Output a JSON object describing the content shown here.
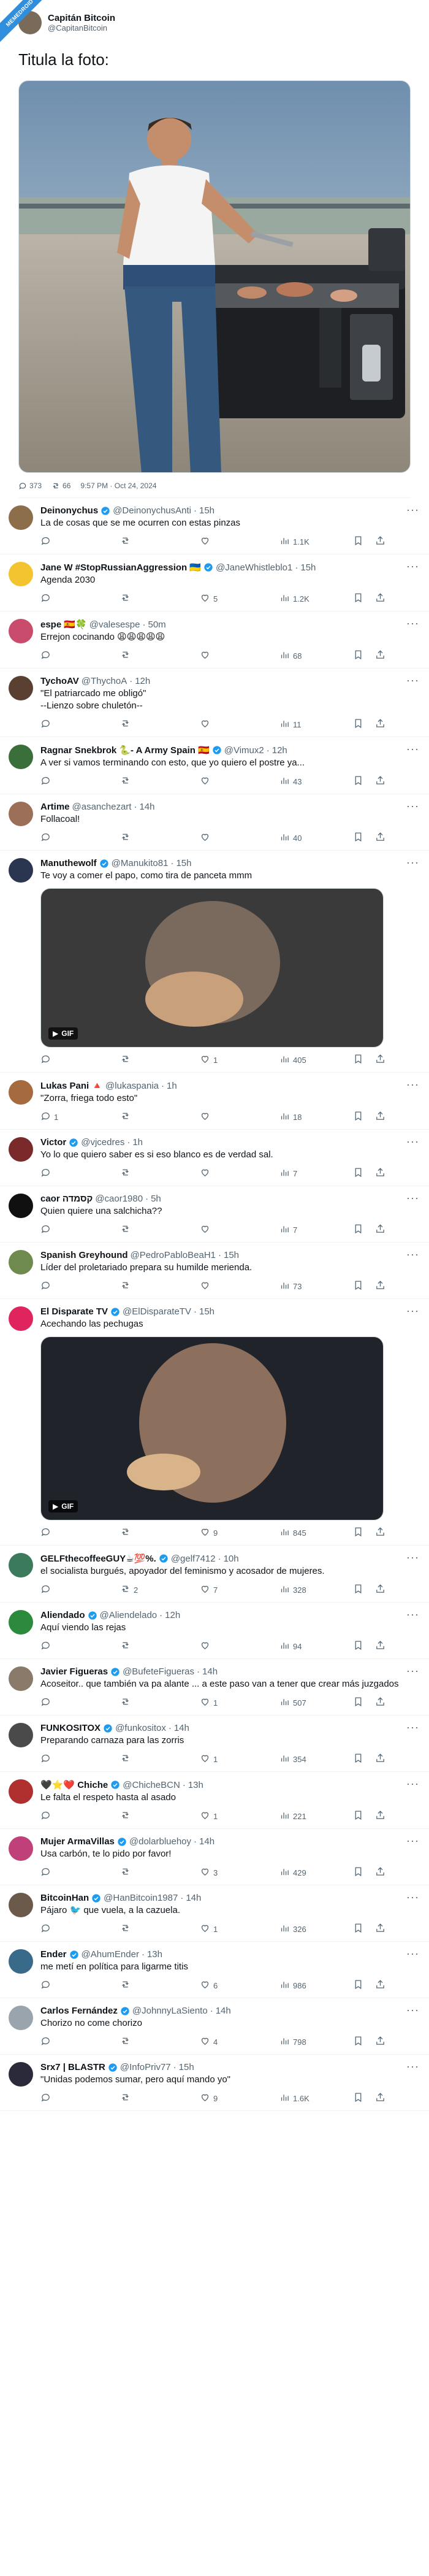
{
  "badge": "MEMEDROID",
  "main": {
    "name": "Capitán Bitcoin",
    "handle": "@CapitanBitcoin",
    "text": "Titula la foto:",
    "photo_alt": "Hombre con camiseta blanca asando carne en una barbacoa",
    "replies": "373",
    "retweets": "66",
    "meta": "9:57 PM · Oct 24, 2024"
  },
  "colors": {
    "accent": "#1d9bf0",
    "muted": "#536471",
    "gold": "#e2b719"
  },
  "replies": [
    {
      "name": "Deinonychus",
      "verified": true,
      "handle": "@DeinonychusAnti",
      "time": "15h",
      "text": "La de cosas que se me ocurren con estas pinzas",
      "replies": "",
      "retweets": "",
      "likes": "",
      "views": "1.1K",
      "avatar_color": "#8d6e4a"
    },
    {
      "name": "Jane W #StopRussianAggression 🇺🇦",
      "verified": true,
      "handle": "@JaneWhistleblo1",
      "time": "15h",
      "text": "Agenda 2030",
      "replies": "",
      "retweets": "",
      "likes": "5",
      "views": "1.2K",
      "avatar_color": "#f4c430"
    },
    {
      "name": "espe 🇪🇸🍀",
      "verified": false,
      "handle": "@valesespe",
      "time": "50m",
      "text": "Errejon cocinando 😩😩😩😩😩",
      "replies": "",
      "retweets": "",
      "likes": "",
      "views": "68",
      "avatar_color": "#c94c6c"
    },
    {
      "name": "TychoAV",
      "verified": false,
      "handle": "@ThychoA",
      "time": "12h",
      "text": "\"El patriarcado me obligó\"\n--Lienzo sobre chuletón--",
      "replies": "",
      "retweets": "",
      "likes": "",
      "views": "11",
      "avatar_color": "#5a4030"
    },
    {
      "name": "Ragnar Snekbrok 🐍- A Army Spain 🇪🇸",
      "verified": true,
      "handle": "@Vimux2",
      "time": "12h",
      "text": "A ver si vamos terminando con esto, que yo quiero el postre ya...",
      "replies": "",
      "retweets": "",
      "likes": "",
      "views": "43",
      "avatar_color": "#3a6e3a"
    },
    {
      "name": "Artime",
      "verified": false,
      "handle": "@asanchezart",
      "time": "14h",
      "text": "Follacoal!",
      "replies": "",
      "retweets": "",
      "likes": "",
      "views": "40",
      "avatar_color": "#9c7058"
    },
    {
      "name": "Manuthewolf",
      "verified": true,
      "handle": "@Manukito81",
      "time": "15h",
      "text": "Te voy a comer el papo, como tira de panceta mmm",
      "replies": "",
      "retweets": "",
      "likes": "1",
      "views": "405",
      "avatar_color": "#2a3550",
      "gif": "GIF"
    },
    {
      "name": "Lukas Pani 🔺",
      "verified": false,
      "handle": "@lukaspania",
      "time": "1h",
      "text": "\"Zorra, friega todo esto\"",
      "replies": "1",
      "retweets": "",
      "likes": "",
      "views": "18",
      "avatar_color": "#a66a3f"
    },
    {
      "name": "Victor",
      "verified": true,
      "handle": "@vjcedres",
      "time": "1h",
      "text": "Yo lo que quiero saber es si eso blanco es de verdad sal.",
      "replies": "",
      "retweets": "",
      "likes": "",
      "views": "7",
      "avatar_color": "#7a2a2a"
    },
    {
      "name": "caor קסמדה",
      "verified": false,
      "handle": "@caor1980",
      "time": "5h",
      "text": "Quien quiere una salchicha??",
      "replies": "",
      "retweets": "",
      "likes": "",
      "views": "7",
      "avatar_color": "#101010"
    },
    {
      "name": "Spanish Greyhound",
      "verified": false,
      "handle": "@PedroPabloBeaH1",
      "time": "15h",
      "text": "Líder del proletariado prepara su humilde merienda.",
      "replies": "",
      "retweets": "",
      "likes": "",
      "views": "73",
      "avatar_color": "#6f8a4e"
    },
    {
      "name": "El Disparate TV",
      "verified": true,
      "handle": "@ElDisparateTV",
      "time": "15h",
      "text": "Acechando las pechugas",
      "replies": "",
      "retweets": "",
      "likes": "9",
      "views": "845",
      "avatar_color": "#e0245e",
      "gif": "GIF"
    },
    {
      "name": "GELFthecoffeeGUY☕💯%.",
      "verified": true,
      "handle": "@gelf7412",
      "time": "10h",
      "text": "el socialista burgués, apoyador del feminismo y acosador de mujeres.",
      "replies": "",
      "retweets": "2",
      "likes": "7",
      "views": "328",
      "avatar_color": "#3b7a5a"
    },
    {
      "name": "Aliendado",
      "verified": true,
      "handle": "@Aliendelado",
      "time": "12h",
      "text": "Aquí viendo las rejas",
      "replies": "",
      "retweets": "",
      "likes": "",
      "views": "94",
      "avatar_color": "#2c8a3c"
    },
    {
      "name": "Javier Figueras",
      "verified": true,
      "handle": "@BufeteFigueras",
      "time": "14h",
      "text": "Acoseitor.. que también va pa alante ... a este paso van a tener que crear más juzgados",
      "replies": "",
      "retweets": "",
      "likes": "1",
      "views": "507",
      "avatar_color": "#8a7a6a"
    },
    {
      "name": "FUNKOSITOX",
      "verified": true,
      "handle": "@funkositox",
      "time": "14h",
      "text": "Preparando carnaza para las zorris",
      "replies": "",
      "retweets": "",
      "likes": "1",
      "views": "354",
      "avatar_color": "#4a4a4a"
    },
    {
      "name": "🖤⭐❤️ Chiche",
      "verified": true,
      "handle": "@ChicheBCN",
      "time": "13h",
      "text": "Le falta el respeto hasta al asado",
      "replies": "",
      "retweets": "",
      "likes": "1",
      "views": "221",
      "avatar_color": "#b03030"
    },
    {
      "name": "Mujer ArmaVillas",
      "verified": true,
      "handle": "@dolarbluehoy",
      "time": "14h",
      "text": "Usa carbón, te lo pido por favor!",
      "replies": "",
      "retweets": "",
      "likes": "3",
      "views": "429",
      "avatar_color": "#c0407a"
    },
    {
      "name": "BitcoinHan",
      "verified": true,
      "handle": "@HanBitcoin1987",
      "time": "14h",
      "text": "Pájaro 🐦 que vuela, a la cazuela.",
      "replies": "",
      "retweets": "",
      "likes": "1",
      "views": "326",
      "avatar_color": "#6b5a4a"
    },
    {
      "name": "Ender",
      "verified": true,
      "handle": "@AhumEnder",
      "time": "13h",
      "text": "me metí en política para ligarme titis",
      "replies": "",
      "retweets": "",
      "likes": "6",
      "views": "986",
      "avatar_color": "#3a6a8a"
    },
    {
      "name": "Carlos Fernández",
      "verified": true,
      "handle": "@JohnnyLaSiento",
      "time": "14h",
      "text": "Chorizo no come chorizo",
      "replies": "",
      "retweets": "",
      "likes": "4",
      "views": "798",
      "avatar_color": "#9aa4ad"
    },
    {
      "name": "Srx7 | BLASTR",
      "verified": true,
      "handle": "@InfoPriv77",
      "time": "15h",
      "text": "\"Unidas podemos sumar, pero aquí mando yo\"",
      "replies": "",
      "retweets": "",
      "likes": "9",
      "views": "1.6K",
      "avatar_color": "#2a2a3a"
    }
  ]
}
